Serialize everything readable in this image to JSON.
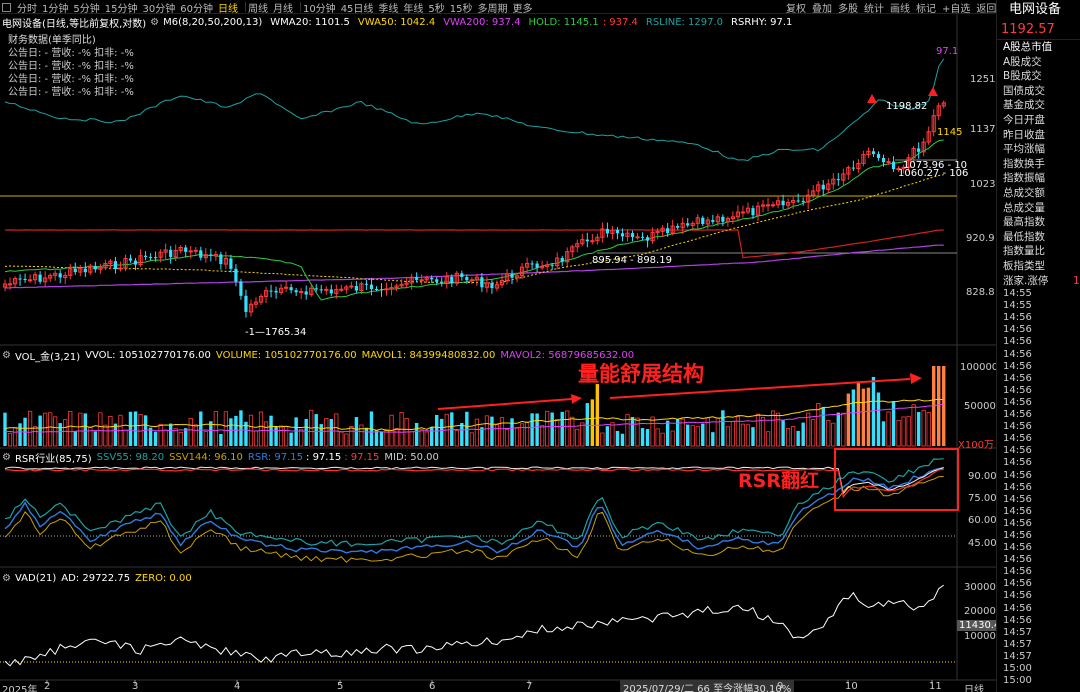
{
  "topbar": {
    "periods": [
      "分时",
      "1分钟",
      "5分钟",
      "15分钟",
      "30分钟",
      "60分钟",
      "日线",
      "周线",
      "月线",
      "10分钟",
      "45日线",
      "季线",
      "年线",
      "5秒",
      "15秒",
      "多周期",
      "更多"
    ],
    "active": "日线",
    "tools": [
      "复权",
      "叠加",
      "多股",
      "统计",
      "画线",
      "标记",
      "+自选",
      "返回"
    ]
  },
  "main": {
    "header": {
      "stock_label": "电网设备(日线,等比前复权,对数)",
      "indicator": "M6(8,20,50,200,13)",
      "wma20_label": "WMA20: 1101.5",
      "vwa50_label": "VWA50: 1042.4",
      "vwa200_label": "VWA200: 937.4",
      "hold_label": "HOLD: 1145.1",
      "hold_extra": ": 937.4",
      "rsline_label": "RSLINE: 1297.0",
      "rsrhy_label": "RSRHY: 97.1"
    },
    "fin": {
      "title": "财务数据(单季同比)",
      "rows": [
        "公告日: -   营收: -%   扣非: -%",
        "公告日: -   营收: -%   扣非: -%",
        "公告日: -   营收: -%   扣非: -%",
        "公告日: -   营收: -%   扣非: -%"
      ]
    },
    "yaxis": [
      "1251",
      "1137",
      "1023",
      "920.9",
      "828.8"
    ],
    "annotations": {
      "top_rs": "97.1",
      "high": "1198.82",
      "hold_side": "1145",
      "a1": "1073.96 - 10",
      "a2": "1060.27 - 106",
      "mid": "895.94 - 898.19",
      "low": "-1—1765.34"
    }
  },
  "vol": {
    "header": {
      "name": "VOL_金(3,21)",
      "vvol": "VVOL: 105102770176.00",
      "volume": "VOLUME: 105102770176.00",
      "mavol1": "MAVOL1: 84399480832.00",
      "mavol2": "MAVOL2: 56879685632.00"
    },
    "annotation": "量能舒展结构",
    "yaxis": [
      "100000",
      "50000"
    ],
    "unit": "X100万"
  },
  "rsr": {
    "header": {
      "name": "RSR行业(85,75)",
      "ssv55": "SSV55: 98.20",
      "ssv144": "SSV144: 96.10",
      "rsr": "RSR: 97.15",
      "rsr2": ": 97.15",
      "rsr3": ": 97.15",
      "mid": "MID: 50.00"
    },
    "annotation": "RSR翻红",
    "yaxis": [
      "90.00",
      "75.00",
      "60.00",
      "45.00"
    ]
  },
  "vad": {
    "header": {
      "name": "VAD(21)",
      "ad": "AD: 29722.75",
      "zero": "ZERO: 0.00"
    },
    "yaxis": [
      "30000",
      "20000",
      "10000"
    ],
    "current": "11430.4"
  },
  "xaxis": {
    "labels": [
      "2025年",
      "2",
      "3",
      "4",
      "5",
      "6",
      "7",
      "9",
      "10",
      "11"
    ],
    "status": "2025/07/29/二 66 至今涨幅30.10%",
    "period": "日线"
  },
  "right_panel": {
    "title": "电网设备",
    "price": "1192.57",
    "items": [
      "A股总市值",
      "A股成交",
      "B股成交",
      "国债成交",
      "基金成交",
      "今日开盘",
      "昨日收盘",
      "平均涨幅",
      "指数换手",
      "指数振幅",
      "总成交额",
      "总成交量",
      "最高指数",
      "最低指数",
      "指数量比",
      "板指类型",
      "涨家.涨停"
    ],
    "item_extra": "1",
    "times": [
      "14:55",
      "14:55",
      "14:56",
      "14:56",
      "14:56",
      "14:56",
      "14:56",
      "14:56",
      "14:56",
      "14:56",
      "14:56",
      "14:56",
      "14:56",
      "14:56",
      "14:56",
      "14:56",
      "14:56",
      "14:56",
      "14:56",
      "14:56",
      "14:56",
      "14:56",
      "14:56",
      "14:56",
      "14:56",
      "14:56",
      "14:56",
      "14:56",
      "14:57",
      "14:57",
      "14:57",
      "15:00",
      "15:00"
    ]
  },
  "colors": {
    "up": "#ff3a3a",
    "down": "#33e0ff",
    "yellow": "#ffd700",
    "purple": "#e040fb",
    "green": "#2ecc40",
    "teal": "#1aa3a3",
    "orange": "#ff9a3a",
    "white": "#ffffff"
  }
}
